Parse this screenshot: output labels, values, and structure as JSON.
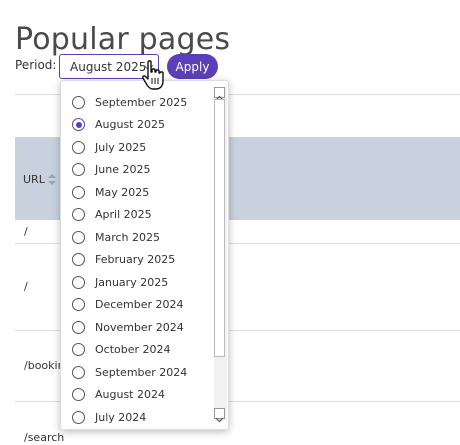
{
  "page": {
    "title": "Popular pages"
  },
  "filter": {
    "period_label": "Period:",
    "selected_period": "August 2025",
    "apply_label": "Apply"
  },
  "table": {
    "url_header": "URL",
    "rows": [
      "/",
      "/",
      "/bookir",
      "/search"
    ]
  },
  "dropdown": {
    "options": [
      {
        "label": "September 2025",
        "checked": false
      },
      {
        "label": "August 2025",
        "checked": true
      },
      {
        "label": "July 2025",
        "checked": false
      },
      {
        "label": "June 2025",
        "checked": false
      },
      {
        "label": "May 2025",
        "checked": false
      },
      {
        "label": "April 2025",
        "checked": false
      },
      {
        "label": "March 2025",
        "checked": false
      },
      {
        "label": "February 2025",
        "checked": false
      },
      {
        "label": "January 2025",
        "checked": false
      },
      {
        "label": "December 2024",
        "checked": false
      },
      {
        "label": "November 2024",
        "checked": false
      },
      {
        "label": "October 2024",
        "checked": false
      },
      {
        "label": "September 2024",
        "checked": false
      },
      {
        "label": "August 2024",
        "checked": false
      },
      {
        "label": "July 2024",
        "checked": false
      }
    ]
  },
  "colors": {
    "accent": "#5b3fb8",
    "table_header": "#c9d1de"
  },
  "icons": [
    "chevron-down-icon",
    "hand-pointer-icon",
    "sort-icon",
    "radio-icon",
    "scroll-up-icon",
    "scroll-down-icon"
  ]
}
